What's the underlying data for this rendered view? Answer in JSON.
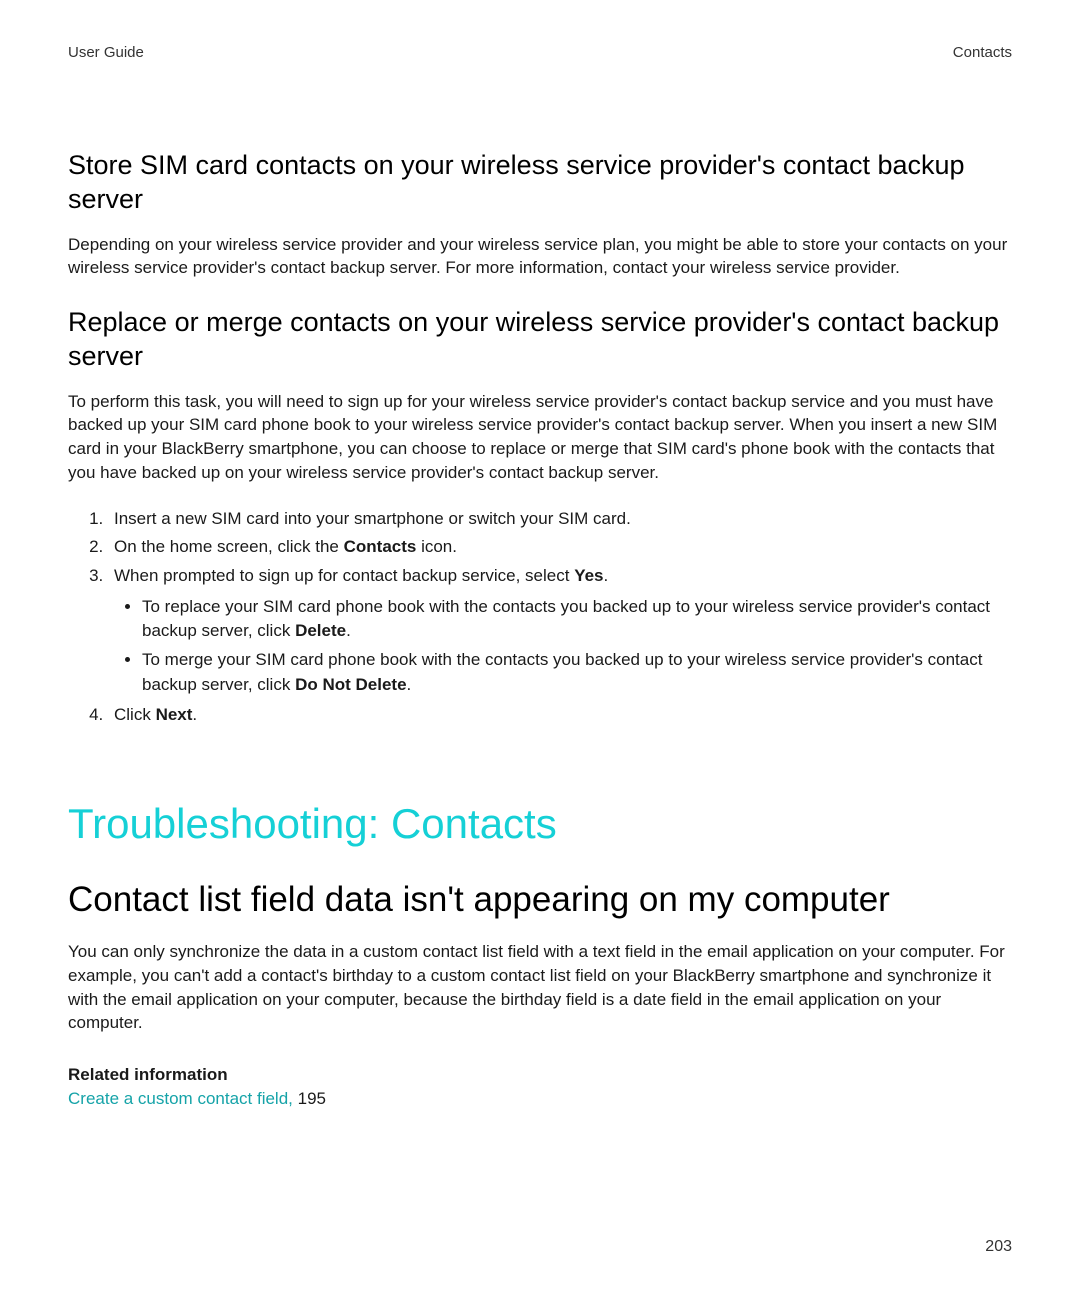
{
  "header": {
    "left": "User Guide",
    "right": "Contacts"
  },
  "section1": {
    "title": "Store SIM card contacts on your wireless service provider's contact backup server",
    "body": "Depending on your wireless service provider and your wireless service plan, you might be able to store your contacts on your wireless service provider's contact backup server. For more information, contact your wireless service provider."
  },
  "section2": {
    "title": "Replace or merge contacts on your wireless service provider's contact backup server",
    "body": "To perform this task, you will need to sign up for your wireless service provider's contact backup service and you must have backed up your SIM card phone book to your wireless service provider's contact backup server. When you insert a new SIM card in your BlackBerry smartphone, you can choose to replace or merge that SIM card's phone book with the contacts that you have backed up on your wireless service provider's contact backup server.",
    "steps": {
      "s1": "Insert a new SIM card into your smartphone or switch your SIM card.",
      "s2_pre": "On the home screen, click the ",
      "s2_bold": "Contacts",
      "s2_post": " icon.",
      "s3_pre": "When prompted to sign up for contact backup service, select ",
      "s3_bold": "Yes",
      "s3_post": ".",
      "bullet1_pre": "To replace your SIM card phone book with the contacts you backed up to your wireless service provider's contact backup server, click ",
      "bullet1_bold": "Delete",
      "bullet1_post": ".",
      "bullet2_pre": "To merge your SIM card phone book with the contacts you backed up to your wireless service provider's contact backup server, click ",
      "bullet2_bold": "Do Not Delete",
      "bullet2_post": ".",
      "s4_pre": "Click ",
      "s4_bold": "Next",
      "s4_post": "."
    }
  },
  "troubleshoot": {
    "heading": "Troubleshooting: Contacts",
    "topic": "Contact list field data isn't appearing on my computer",
    "body": "You can only synchronize the data in a custom contact list field with a text field in the email application on your computer. For example, you can't add a contact's birthday to a custom contact list field on your BlackBerry smartphone and synchronize it with the email application on your computer, because the birthday field is a date field in the email application on your computer."
  },
  "related": {
    "label": "Related information",
    "link": "Create a custom contact field,",
    "page": " 195"
  },
  "page_number": "203"
}
